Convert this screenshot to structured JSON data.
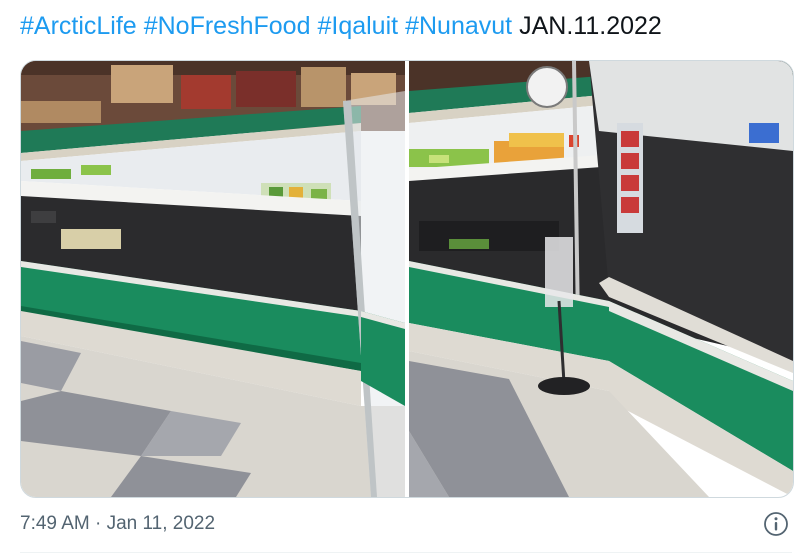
{
  "tweet": {
    "hashtags": [
      "#ArcticLife",
      "#NoFreshFood",
      "#Iqaluit",
      "#Nunavut"
    ],
    "date_text": "JAN.11.2022",
    "timestamp": "7:49 AM · Jan 11, 2022"
  },
  "icons": {
    "info": "info-circle-icon"
  },
  "colors": {
    "hashtag": "#1d9bf0",
    "text": "#0f1419",
    "secondary": "#536471",
    "fridge_green": "#1a8c5e"
  }
}
